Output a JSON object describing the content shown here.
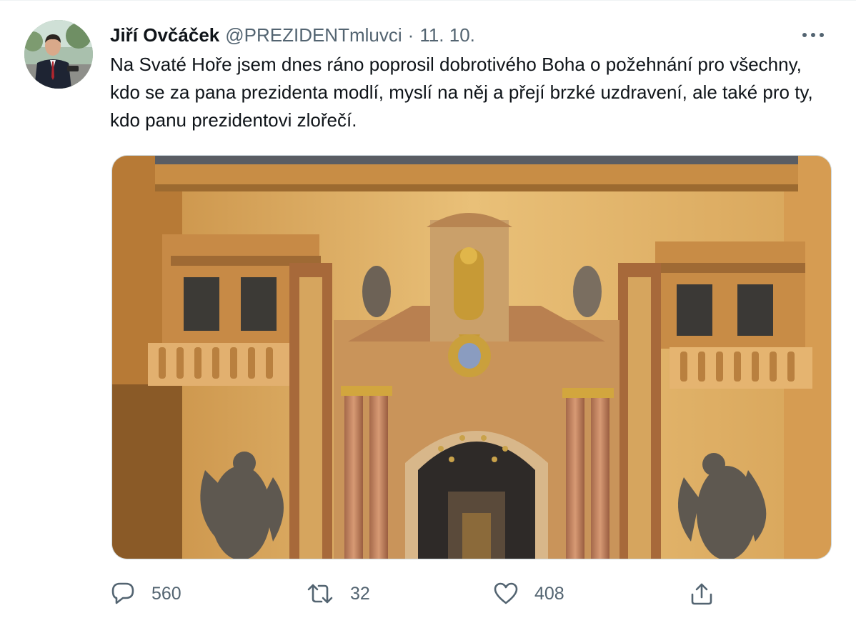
{
  "tweet": {
    "author": {
      "name": "Jiří Ovčáček",
      "handle": "@PREZIDENTmluvci",
      "avatar_icon": "profile-photo"
    },
    "separator": "·",
    "date": "11. 10.",
    "more_icon": "more-horizontal-icon",
    "text": "Na Svaté Hoře jsem dnes ráno poprosil dobrotivého Boha o požehnání pro všechny, kdo se za pana prezidenta modlí, myslí na něj a přejí brzké uzdravení, ale také pro ty, kdo panu prezidentovi zlořečí.",
    "media": {
      "description_icon": "photo-church-facade"
    },
    "actions": {
      "reply": {
        "icon": "reply-icon",
        "count": "560"
      },
      "retweet": {
        "icon": "retweet-icon",
        "count": "32"
      },
      "like": {
        "icon": "like-icon",
        "count": "408"
      },
      "share": {
        "icon": "share-icon"
      }
    }
  },
  "colors": {
    "text_primary": "#0f1419",
    "text_secondary": "#536471",
    "border": "#cfd9de"
  }
}
